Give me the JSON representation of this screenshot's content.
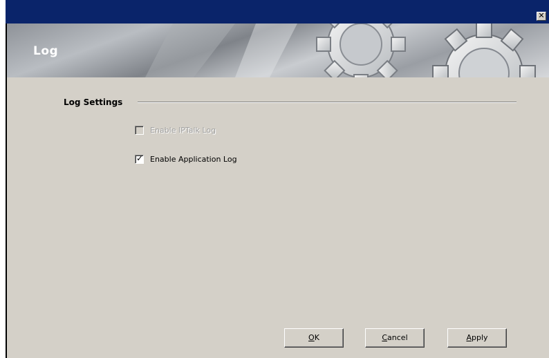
{
  "titlebar": {
    "close_glyph": "✕"
  },
  "banner": {
    "title": "Log",
    "graphic": "gears-icon"
  },
  "log_settings": {
    "section_label": "Log Settings",
    "options": [
      {
        "label": "Enable IPTalk Log",
        "checked": false,
        "enabled": false
      },
      {
        "label": "Enable Application Log",
        "checked": true,
        "enabled": true
      }
    ]
  },
  "buttons": {
    "ok": {
      "accel": "O",
      "rest": "K"
    },
    "cancel": {
      "accel": "C",
      "rest": "ancel"
    },
    "apply": {
      "accel": "A",
      "rest": "pply"
    }
  },
  "colors": {
    "titlebar": "#0a246a",
    "window_bg": "#d4d0c8",
    "disabled_text": "#a0a0a0"
  }
}
